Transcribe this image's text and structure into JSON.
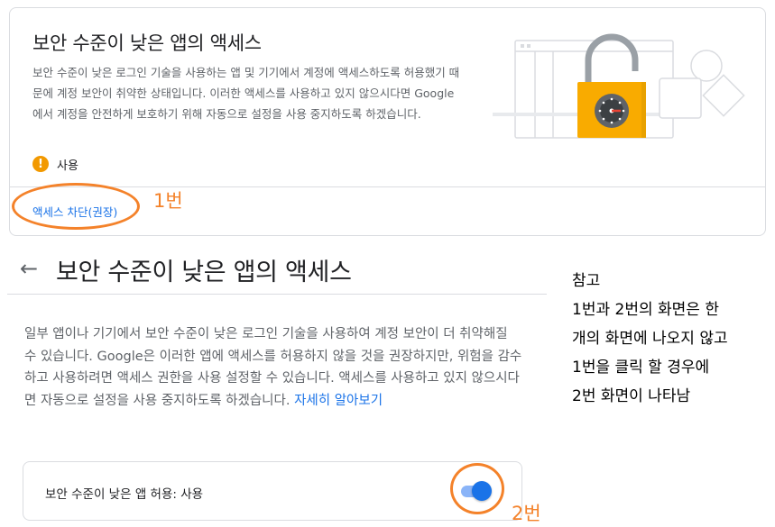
{
  "card1": {
    "title": "보안 수준이 낮은 앱의 액세스",
    "description": "보안 수준이 낮은 로그인 기술을 사용하는 앱 및 기기에서 계정에 액세스하도록 허용했기 때문에 계정 보안이 취약한 상태입니다. 이러한 액세스를 사용하고 있지 않으시다면 Google에서 계정을 안전하게 보호하기 위해 자동으로 설정을 사용 중지하도록 하겠습니다.",
    "warning_glyph": "!",
    "status_text": "사용",
    "block_link": "액세스 차단(권장)",
    "annotation": "1번",
    "illustration_icon": "unlocked-padlock-illustration"
  },
  "section2": {
    "back_icon": "←",
    "title": "보안 수준이 낮은 앱의 액세스",
    "body": "일부 앱이나 기기에서 보안 수준이 낮은 로그인 기술을 사용하여 계정 보안이 더 취약해질 수 있습니다. Google은 이러한 앱에 액세스를 허용하지 않을 것을 권장하지만, 위험을 감수하고 사용하려면 액세스 권한을 사용 설정할 수 있습니다. 액세스를 사용하고 있지 않으시다면 자동으로 설정을 사용 중지하도록 하겠습니다.",
    "learn_more": "자세히 알아보기",
    "toggle_label": "보안 수준이 낮은 앱 허용: 사용",
    "toggle_on": true,
    "annotation": "2번"
  },
  "note": {
    "lines": [
      "참고",
      "1번과 2번의 화면은 한",
      "개의 화면에 나오지 않고",
      "1번을 클릭 할 경우에",
      "2번 화면이 나타남"
    ]
  },
  "colors": {
    "accent_blue": "#1a73e8",
    "annotation_orange": "#f4822a",
    "warning_orange": "#f29900",
    "lock_yellow": "#f9ab00"
  }
}
